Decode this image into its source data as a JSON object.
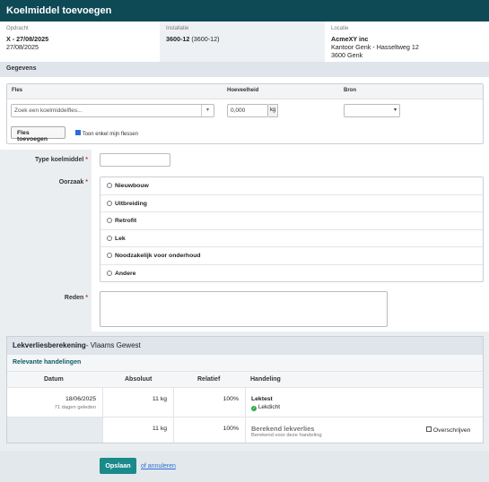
{
  "title": "Koelmiddel toevoegen",
  "info": {
    "opdracht_label": "Opdracht",
    "opdracht_value": "X - 27/08/2025",
    "opdracht_date": "27/08/2025",
    "installatie_label": "Installatie",
    "installatie_value": "3600-12",
    "installatie_code": "(3600-12)",
    "locatie_label": "Locatie",
    "locatie_name": "AcmeXY inc",
    "locatie_address": "Kantoor Genk - Hasseltweg 12",
    "locatie_city": "3600 Genk"
  },
  "gegevens_title": "Gegevens",
  "fles": {
    "col_fles": "Fles",
    "col_hoeveelheid": "Hoeveelheid",
    "col_bron": "Bron",
    "search_placeholder": "Zoek een koelmiddelfles...",
    "quantity_value": "0,000",
    "quantity_unit": "kg",
    "bron_value": "",
    "add_button": "Fles toevoegen",
    "only_mine_label": "Toon enkel mijn flessen",
    "only_mine_checked": true
  },
  "form": {
    "type_label": "Type koelmiddel",
    "oorzaak_label": "Oorzaak",
    "reden_label": "Reden",
    "required_mark": "*",
    "type_value": "",
    "reden_value": "",
    "oorzaak_options": [
      "Nieuwbouw",
      "Uitbreiding",
      "Retrofit",
      "Lek",
      "Noodzakelijk voor onderhoud",
      "Andere"
    ]
  },
  "lek": {
    "title": "Lekverliesberekening",
    "region": "- Vlaams Gewest",
    "subtitle": "Relevante handelingen",
    "headers": {
      "datum": "Datum",
      "absoluut": "Absoluut",
      "relatief": "Relatief",
      "handeling": "Handeling"
    },
    "row1": {
      "datum": "18/06/2025",
      "ago": "71 dagen geleden",
      "absoluut": "11 kg",
      "relatief": "100%",
      "handeling": "Lektest",
      "status": "Lekdicht"
    },
    "row2": {
      "absoluut": "11 kg",
      "relatief": "100%",
      "handeling": "Berekend lekverlies",
      "note": "Berekend voor deze handeling",
      "override_label": "Overschrijven"
    },
    "status_color": "#2eaa4a"
  },
  "footer": {
    "save_button": "Opslaan",
    "cancel_link": "of annuleren"
  },
  "colors": {
    "header": "#0e4a55",
    "primary": "#1a8a8a",
    "link": "#2a6fd6"
  }
}
